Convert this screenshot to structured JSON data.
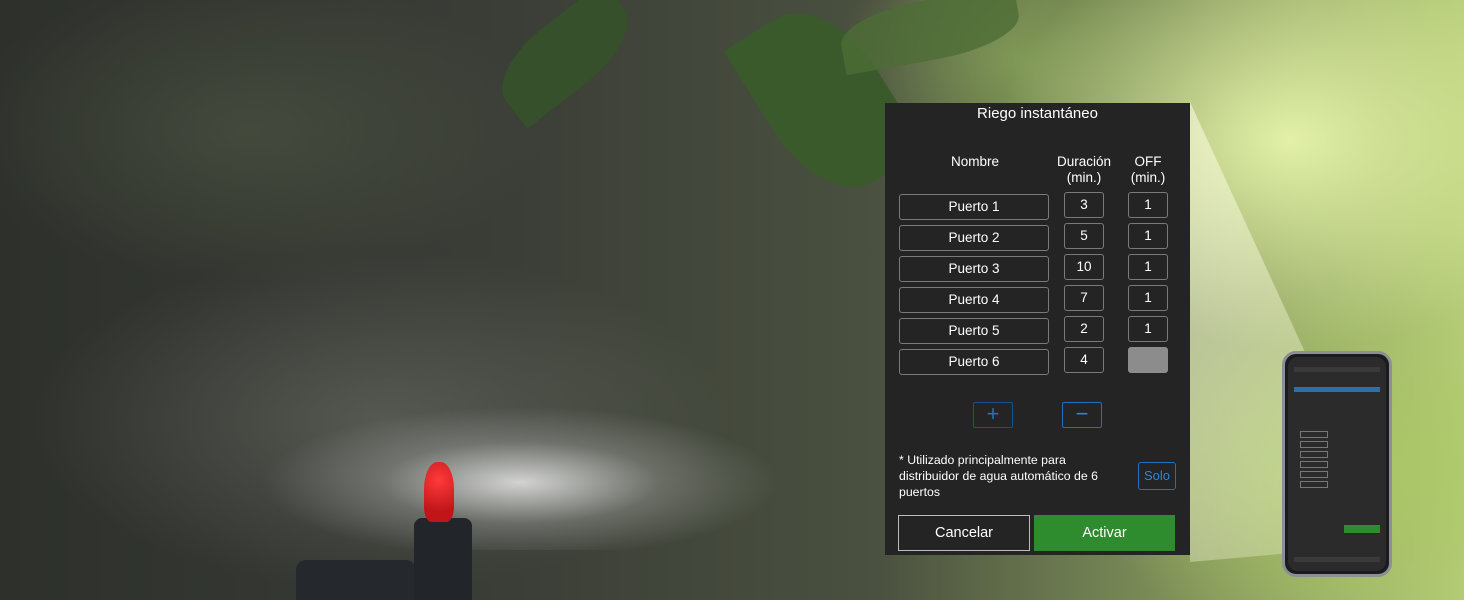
{
  "dialog": {
    "title": "Riego instantáneo",
    "headers": {
      "name": "Nombre",
      "duration": "Duración\n(min.)",
      "off": "OFF\n(min.)"
    },
    "ports": [
      {
        "name": "Puerto 1",
        "duration": "3",
        "off": "1"
      },
      {
        "name": "Puerto 2",
        "duration": "5",
        "off": "1"
      },
      {
        "name": "Puerto 3",
        "duration": "10",
        "off": "1"
      },
      {
        "name": "Puerto 4",
        "duration": "7",
        "off": "1"
      },
      {
        "name": "Puerto 5",
        "duration": "2",
        "off": "1"
      },
      {
        "name": "Puerto 6",
        "duration": "4",
        "off": ""
      }
    ],
    "add_label": "+",
    "remove_label": "−",
    "note": "* Utilizado principalmente para distribuidor de agua automático de 6 puertos",
    "solo_label": "Solo",
    "cancel_label": "Cancelar",
    "activate_label": "Activar"
  },
  "colors": {
    "panel_bg": "#242424",
    "accent_blue": "#2d86e0",
    "activate_green": "#2e8b2e",
    "disabled_gray": "#8c8c8c"
  }
}
